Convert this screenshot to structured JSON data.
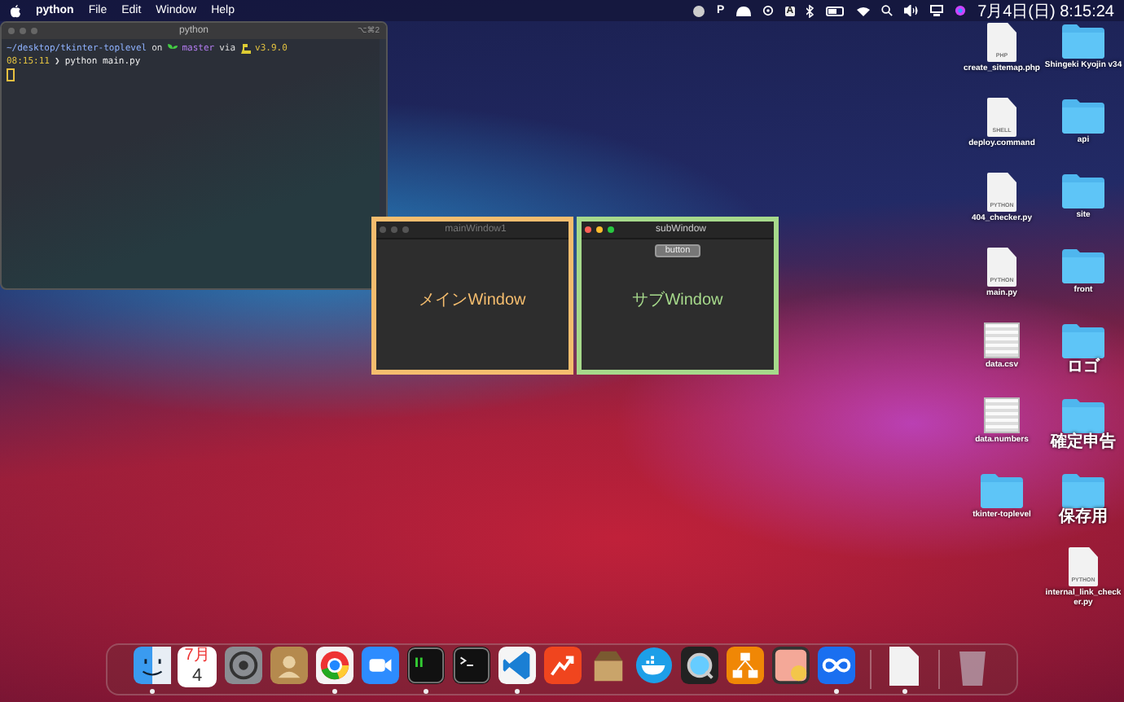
{
  "menubar": {
    "app": "python",
    "menus": [
      "File",
      "Edit",
      "Window",
      "Help"
    ],
    "status_letters": [
      "P",
      "A"
    ],
    "clock": "7月4日(日) 8:15:24"
  },
  "terminal": {
    "title": "python",
    "shortcut": "⌥⌘2",
    "prompt_path": "~/desktop/tkinter-toplevel",
    "on": "on",
    "branch": "master",
    "via": "via",
    "version": "v3.9.0",
    "time": "08:15:11",
    "arrow": "❯",
    "command": "python main.py"
  },
  "windows": [
    {
      "title": "mainWindow1",
      "active": false,
      "color": "#f5bd6e",
      "label": "メインWindow"
    },
    {
      "title": "subWindow",
      "active": true,
      "color": "#a6d98b",
      "label": "サブWindow",
      "button": "button"
    }
  ],
  "desktop_icons": [
    {
      "name": "create_sitemap.php",
      "kind": "file",
      "badge": "PHP"
    },
    {
      "name": "Shingeki Kyojin v34",
      "kind": "folder"
    },
    {
      "name": "deploy.command",
      "kind": "file",
      "badge": "SHELL"
    },
    {
      "name": "api",
      "kind": "folder"
    },
    {
      "name": "404_checker.py",
      "kind": "file",
      "badge": "PYTHON"
    },
    {
      "name": "site",
      "kind": "folder"
    },
    {
      "name": "main.py",
      "kind": "file",
      "badge": "PYTHON"
    },
    {
      "name": "front",
      "kind": "folder"
    },
    {
      "name": "data.csv",
      "kind": "sheet"
    },
    {
      "name": "ロゴ",
      "kind": "folder"
    },
    {
      "name": "data.numbers",
      "kind": "sheet"
    },
    {
      "name": "確定申告",
      "kind": "folder"
    },
    {
      "name": "tkinter-toplevel",
      "kind": "folder"
    },
    {
      "name": "保存用",
      "kind": "folder"
    },
    {
      "name": "internal_link_checker.py",
      "kind": "file",
      "badge": "PYTHON"
    }
  ],
  "dock": {
    "items": [
      {
        "kind": "finder",
        "running": true
      },
      {
        "kind": "calendar",
        "month": "7月",
        "day": "4",
        "running": false
      },
      {
        "kind": "settings",
        "running": false
      },
      {
        "kind": "contacts",
        "running": false
      },
      {
        "kind": "browser",
        "running": true
      },
      {
        "kind": "video",
        "running": false
      },
      {
        "kind": "terminal-green",
        "running": true
      },
      {
        "kind": "terminal",
        "running": false
      },
      {
        "kind": "editor",
        "running": true
      },
      {
        "kind": "chart",
        "running": false
      },
      {
        "kind": "archive",
        "running": false
      },
      {
        "kind": "whale",
        "running": false
      },
      {
        "kind": "player",
        "running": false
      },
      {
        "kind": "diagram",
        "running": false
      },
      {
        "kind": "preview",
        "running": false
      },
      {
        "kind": "infinity",
        "running": true
      },
      {
        "kind": "separator"
      },
      {
        "kind": "document",
        "running": true
      },
      {
        "kind": "separator"
      },
      {
        "kind": "trash",
        "running": false
      }
    ]
  }
}
